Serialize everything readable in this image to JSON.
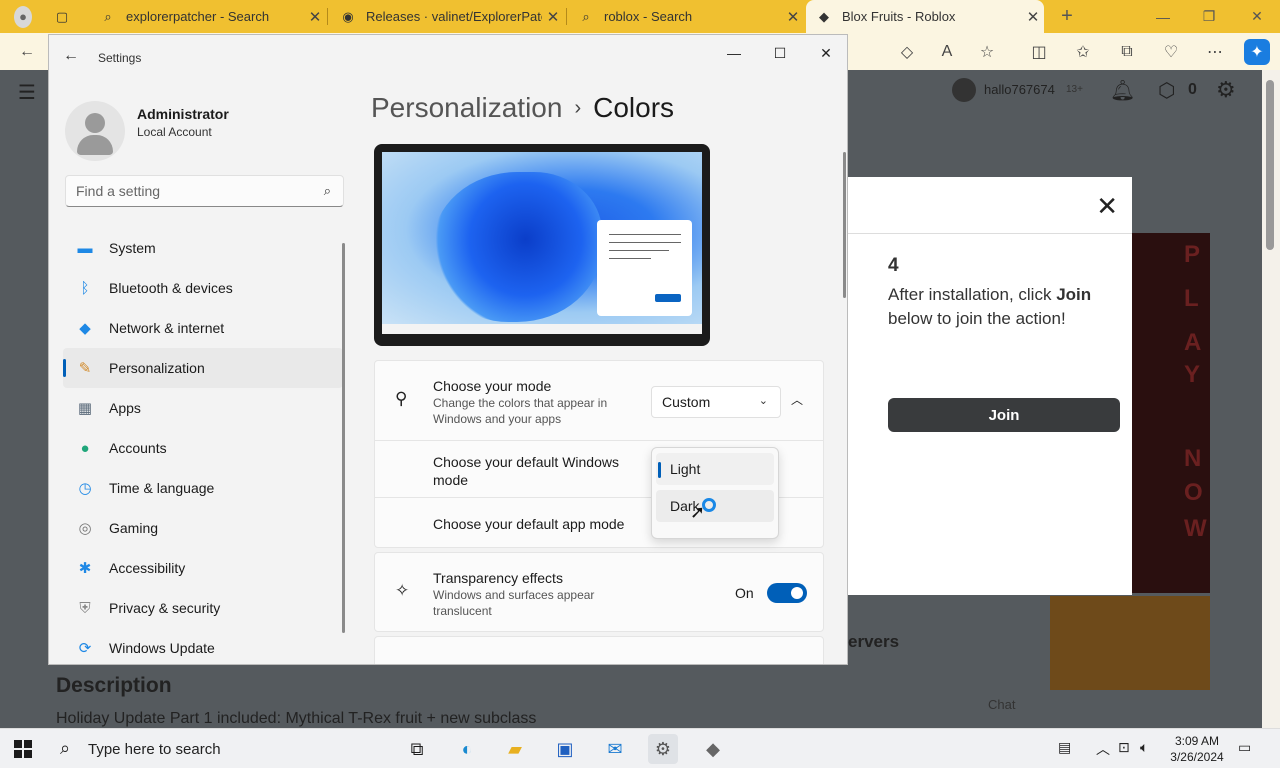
{
  "browser": {
    "tabs": [
      {
        "title": "explorerpatcher - Search",
        "icon": "search-icon",
        "active": false
      },
      {
        "title": "Releases · valinet/ExplorerPatcher",
        "icon": "github-icon",
        "active": false
      },
      {
        "title": "roblox - Search",
        "icon": "search-icon",
        "active": false
      },
      {
        "title": "Blox Fruits - Roblox",
        "icon": "roblox-icon",
        "active": true
      }
    ],
    "new_tab_glyph": "+",
    "close_glyph": "✕"
  },
  "roblox": {
    "username": "hallo767674",
    "age_badge": "13+",
    "robux": "0",
    "dialog": {
      "step": "4",
      "text_before": "After installation, click ",
      "text_bold": "Join",
      "text_after": " below to join the action!",
      "join_label": "Join"
    },
    "banner_letters": [
      "P",
      "L",
      "A",
      "Y",
      "N",
      "O",
      "W"
    ],
    "servers_label": "ervers",
    "description_heading": "Description",
    "description_text": "Holiday Update Part 1 included: Mythical T-Rex fruit + new subclass",
    "chat_label": "Chat"
  },
  "settings": {
    "window_title": "Settings",
    "account": {
      "name": "Administrator",
      "type": "Local Account"
    },
    "search_placeholder": "Find a setting",
    "nav": [
      {
        "label": "System",
        "icon": "monitor-icon",
        "color": "#1e88e5"
      },
      {
        "label": "Bluetooth & devices",
        "icon": "bluetooth-icon",
        "color": "#1e88e5"
      },
      {
        "label": "Network & internet",
        "icon": "wifi-icon",
        "color": "#1e88e5"
      },
      {
        "label": "Personalization",
        "icon": "paintbrush-icon",
        "color": "#d28a2a",
        "selected": true
      },
      {
        "label": "Apps",
        "icon": "apps-icon",
        "color": "#5a6a7a"
      },
      {
        "label": "Accounts",
        "icon": "person-icon",
        "color": "#1fa67a"
      },
      {
        "label": "Time & language",
        "icon": "globe-clock-icon",
        "color": "#1e88e5"
      },
      {
        "label": "Gaming",
        "icon": "gamepad-icon",
        "color": "#777777"
      },
      {
        "label": "Accessibility",
        "icon": "accessibility-icon",
        "color": "#1e88e5"
      },
      {
        "label": "Privacy & security",
        "icon": "shield-icon",
        "color": "#888888"
      },
      {
        "label": "Windows Update",
        "icon": "update-icon",
        "color": "#1e88e5"
      }
    ],
    "breadcrumb": {
      "parent": "Personalization",
      "current": "Colors"
    },
    "mode": {
      "title": "Choose your mode",
      "subtitle": "Change the colors that appear in Windows and your apps",
      "value": "Custom"
    },
    "windows_mode": {
      "title": "Choose your default Windows mode"
    },
    "app_mode": {
      "title": "Choose your default app mode"
    },
    "dropdown_options": [
      {
        "label": "Light",
        "selected": true
      },
      {
        "label": "Dark",
        "selected": false
      }
    ],
    "transparency": {
      "title": "Transparency effects",
      "subtitle": "Windows and surfaces appear translucent",
      "state_label": "On",
      "on": true
    }
  },
  "taskbar": {
    "search_placeholder": "Type here to search",
    "time": "3:09 AM",
    "date": "3/26/2024"
  },
  "colors": {
    "accent": "#005fb8",
    "tabbar": "#f0c030"
  }
}
